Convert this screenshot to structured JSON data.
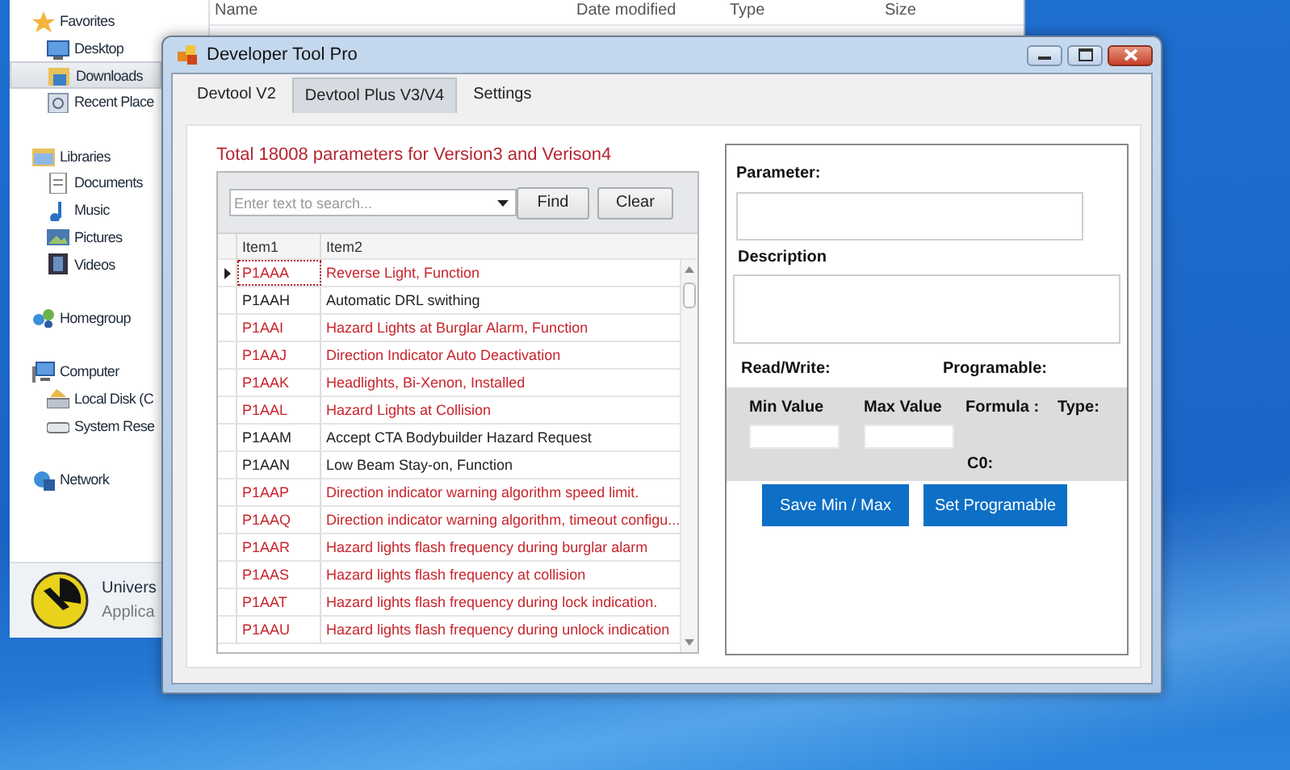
{
  "explorer": {
    "columns": [
      "Name",
      "Date modified",
      "Type",
      "Size"
    ],
    "nav": [
      {
        "label": "Favorites",
        "selected": false,
        "children": [
          {
            "label": "Desktop",
            "selected": false
          },
          {
            "label": "Downloads",
            "selected": true
          },
          {
            "label": "Recent Place",
            "selected": false
          }
        ]
      },
      {
        "label": "Libraries",
        "selected": false,
        "children": [
          {
            "label": "Documents",
            "selected": false
          },
          {
            "label": "Music",
            "selected": false
          },
          {
            "label": "Pictures",
            "selected": false
          },
          {
            "label": "Videos",
            "selected": false
          }
        ]
      },
      {
        "label": "Homegroup",
        "selected": false
      },
      {
        "label": "Computer",
        "selected": false,
        "children": [
          {
            "label": "Local Disk (C",
            "selected": false
          },
          {
            "label": "System Rese",
            "selected": false
          }
        ]
      },
      {
        "label": "Network",
        "selected": false
      }
    ],
    "details": {
      "title": "Univers",
      "subtitle": "Applica"
    }
  },
  "window": {
    "title": "Developer Tool Pro",
    "tabs": [
      {
        "label": "Devtool V2",
        "selected": false
      },
      {
        "label": "Devtool Plus V3/V4",
        "selected": true
      },
      {
        "label": "Settings",
        "selected": false
      }
    ],
    "summary": "Total 18008 parameters for Version3 and Verison4",
    "search": {
      "placeholder": "Enter text to search..."
    },
    "search_buttons": [
      "Find",
      "Clear"
    ],
    "table": {
      "columns": [
        "Item1",
        "Item2"
      ],
      "rows": [
        {
          "item1": "P1AAA",
          "item2": "Reverse Light, Function",
          "color": "#c8242c",
          "selected": true
        },
        {
          "item1": "P1AAH",
          "item2": "Automatic DRL swithing",
          "color": "#222222",
          "selected": false
        },
        {
          "item1": "P1AAI",
          "item2": "Hazard Lights at Burglar Alarm, Function",
          "color": "#c8242c",
          "selected": false
        },
        {
          "item1": "P1AAJ",
          "item2": "Direction Indicator Auto Deactivation",
          "color": "#c8242c",
          "selected": false
        },
        {
          "item1": "P1AAK",
          "item2": "Headlights, Bi-Xenon, Installed",
          "color": "#c8242c",
          "selected": false
        },
        {
          "item1": "P1AAL",
          "item2": "Hazard Lights at Collision",
          "color": "#c8242c",
          "selected": false
        },
        {
          "item1": "P1AAM",
          "item2": "Accept CTA Bodybuilder Hazard Request",
          "color": "#222222",
          "selected": false
        },
        {
          "item1": "P1AAN",
          "item2": "Low Beam Stay-on, Function",
          "color": "#222222",
          "selected": false
        },
        {
          "item1": "P1AAP",
          "item2": "Direction indicator warning algorithm speed limit.",
          "color": "#c8242c",
          "selected": false
        },
        {
          "item1": "P1AAQ",
          "item2": "Direction indicator warning algorithm, timeout configu...",
          "color": "#c8242c",
          "selected": false
        },
        {
          "item1": "P1AAR",
          "item2": "Hazard lights flash frequency during burglar alarm",
          "color": "#c8242c",
          "selected": false
        },
        {
          "item1": "P1AAS",
          "item2": "Hazard lights flash frequency at collision",
          "color": "#c8242c",
          "selected": false
        },
        {
          "item1": "P1AAT",
          "item2": "Hazard lights flash frequency during lock indication.",
          "color": "#c8242c",
          "selected": false
        },
        {
          "item1": "P1AAU",
          "item2": "Hazard lights flash frequency during unlock indication",
          "color": "#c8242c",
          "selected": false
        }
      ]
    },
    "details": {
      "parameter_label": "Parameter:",
      "description_label": "Description",
      "read_write_label": "Read/Write:",
      "programable_label": "Programable:",
      "min_label": "Min Value",
      "max_label": "Max Value",
      "formula_label": "Formula :",
      "type_label": "Type:",
      "c0_label": "C0:",
      "buttons": [
        "Save Min / Max",
        "Set Programable"
      ]
    }
  }
}
